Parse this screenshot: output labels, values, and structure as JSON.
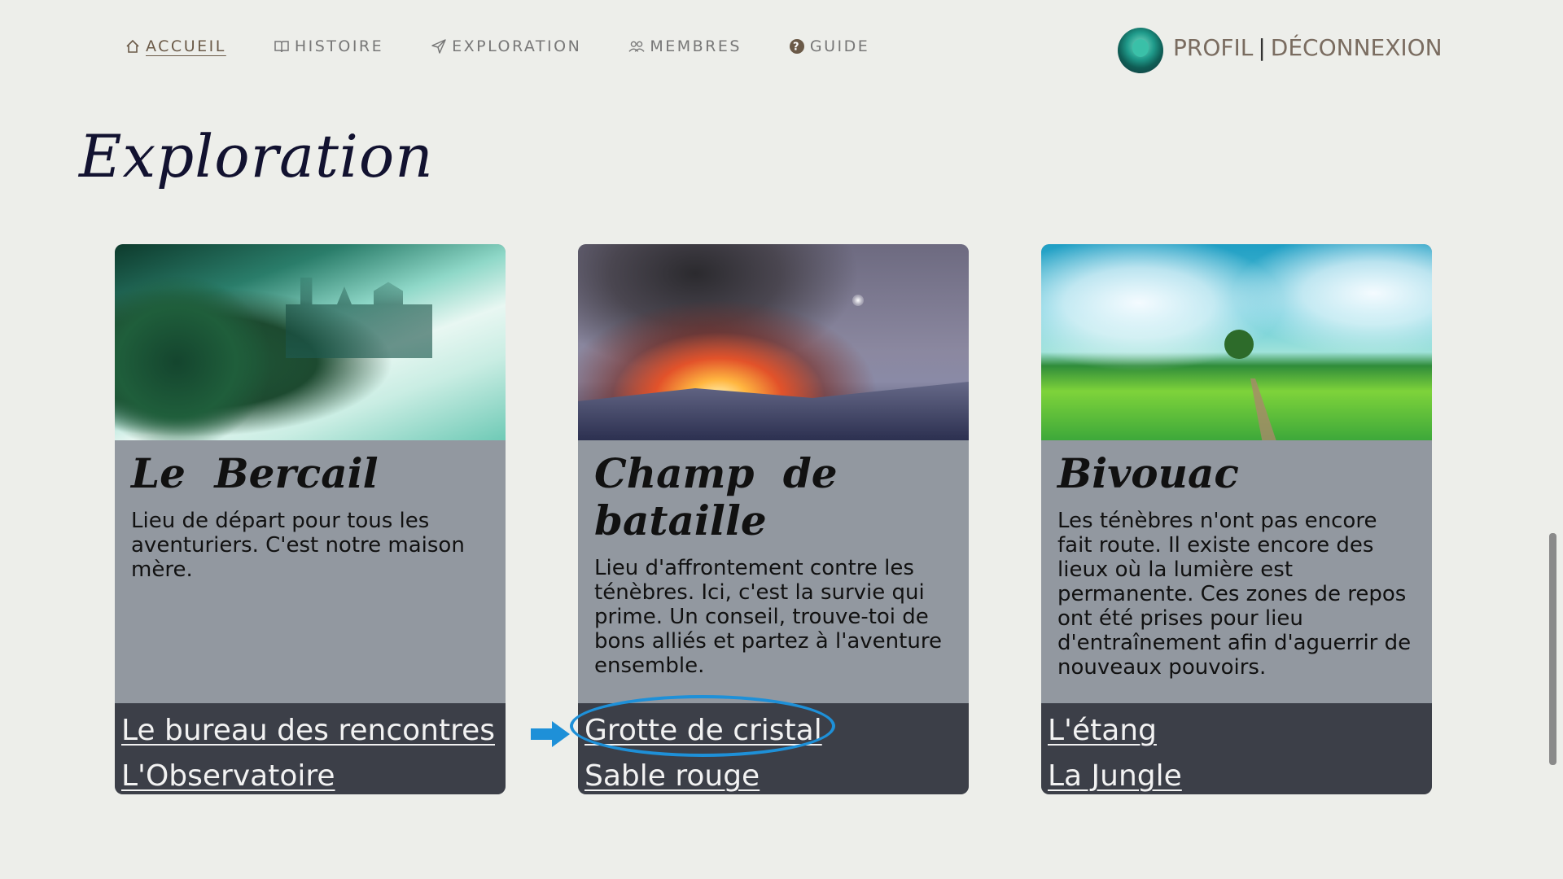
{
  "nav": {
    "items": [
      {
        "label": "ACCUEIL",
        "icon": "home-icon"
      },
      {
        "label": "HISTOIRE",
        "icon": "book-icon"
      },
      {
        "label": "EXPLORATION",
        "icon": "paper-plane-icon"
      },
      {
        "label": "MEMBRES",
        "icon": "users-icon"
      },
      {
        "label": "GUIDE",
        "icon": "help-icon"
      }
    ]
  },
  "account": {
    "profile": "PROFIL",
    "separator": "|",
    "logout": "DÉCONNEXION"
  },
  "page": {
    "title": "Exploration"
  },
  "cards": [
    {
      "title": "Le Bercail",
      "description": "Lieu de départ pour tous les aventuriers. C'est notre maison mère.",
      "links": [
        "Le bureau des rencontres",
        "L'Observatoire"
      ]
    },
    {
      "title": "Champ de bataille",
      "description": "Lieu d'affrontement contre les ténèbres. Ici, c'est la survie qui prime. Un conseil, trouve-toi de bons alliés et partez à l'aventure ensemble.",
      "links": [
        "Grotte de cristal",
        "Sable rouge"
      ]
    },
    {
      "title": "Bivouac",
      "description": "Les ténèbres n'ont pas encore fait route. Il existe encore des lieux où la lumière est permanente. Ces zones de repos ont été prises pour lieu d'entraînement afin d'aguerrir de nouveaux pouvoirs.",
      "links": [
        "L'étang",
        "La Jungle"
      ]
    }
  ],
  "colors": {
    "background": "#edeeea",
    "card_body": "#9298a0",
    "card_links": "#3c3f48",
    "annotation": "#1e90d8"
  }
}
